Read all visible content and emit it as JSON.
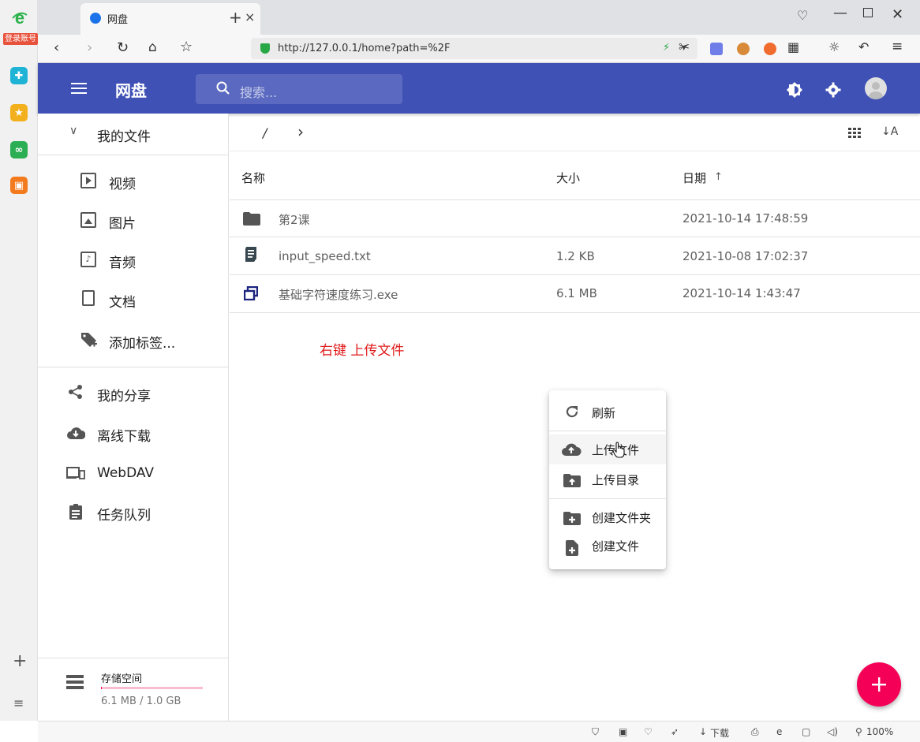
{
  "browser": {
    "tab_title": "网盘",
    "url": "http://127.0.0.1/home?path=%2F",
    "login_label": "登录账号",
    "status_download": "下载",
    "status_zoom": "100%"
  },
  "app": {
    "title": "网盘",
    "search_placeholder": "搜索...",
    "accent": "#3f51b5",
    "fab_color": "#f50057"
  },
  "sidebar": {
    "my_files": "我的文件",
    "items": [
      {
        "label": "视频",
        "icon": "video-icon"
      },
      {
        "label": "图片",
        "icon": "image-icon"
      },
      {
        "label": "音频",
        "icon": "audio-icon"
      },
      {
        "label": "文档",
        "icon": "document-icon"
      },
      {
        "label": "添加标签...",
        "icon": "tag-add-icon"
      }
    ],
    "my_share": "我的分享",
    "offline_download": "离线下载",
    "webdav": "WebDAV",
    "task_queue": "任务队列",
    "storage_label": "存储空间",
    "storage_usage": "6.1 MB / 1.0 GB",
    "storage_fraction": 0.006
  },
  "breadcrumb": {
    "path": "/",
    "chevron": "›"
  },
  "table": {
    "headers": {
      "name": "名称",
      "size": "大小",
      "date": "日期"
    },
    "rows": [
      {
        "name": "第2课",
        "size": "",
        "date": "2021-10-14 17:48:59",
        "icon": "folder-icon"
      },
      {
        "name": "input_speed.txt",
        "size": "1.2 KB",
        "date": "2021-10-08 17:02:37",
        "icon": "text-file-icon"
      },
      {
        "name": "基础字符速度练习.exe",
        "size": "6.1 MB",
        "date": "2021-10-14 1:43:47",
        "icon": "exe-file-icon"
      }
    ]
  },
  "annotation": "右键 上传文件",
  "context_menu": {
    "refresh": "刷新",
    "upload_file": "上传文件",
    "upload_dir": "上传目录",
    "create_folder": "创建文件夹",
    "create_file": "创建文件"
  }
}
